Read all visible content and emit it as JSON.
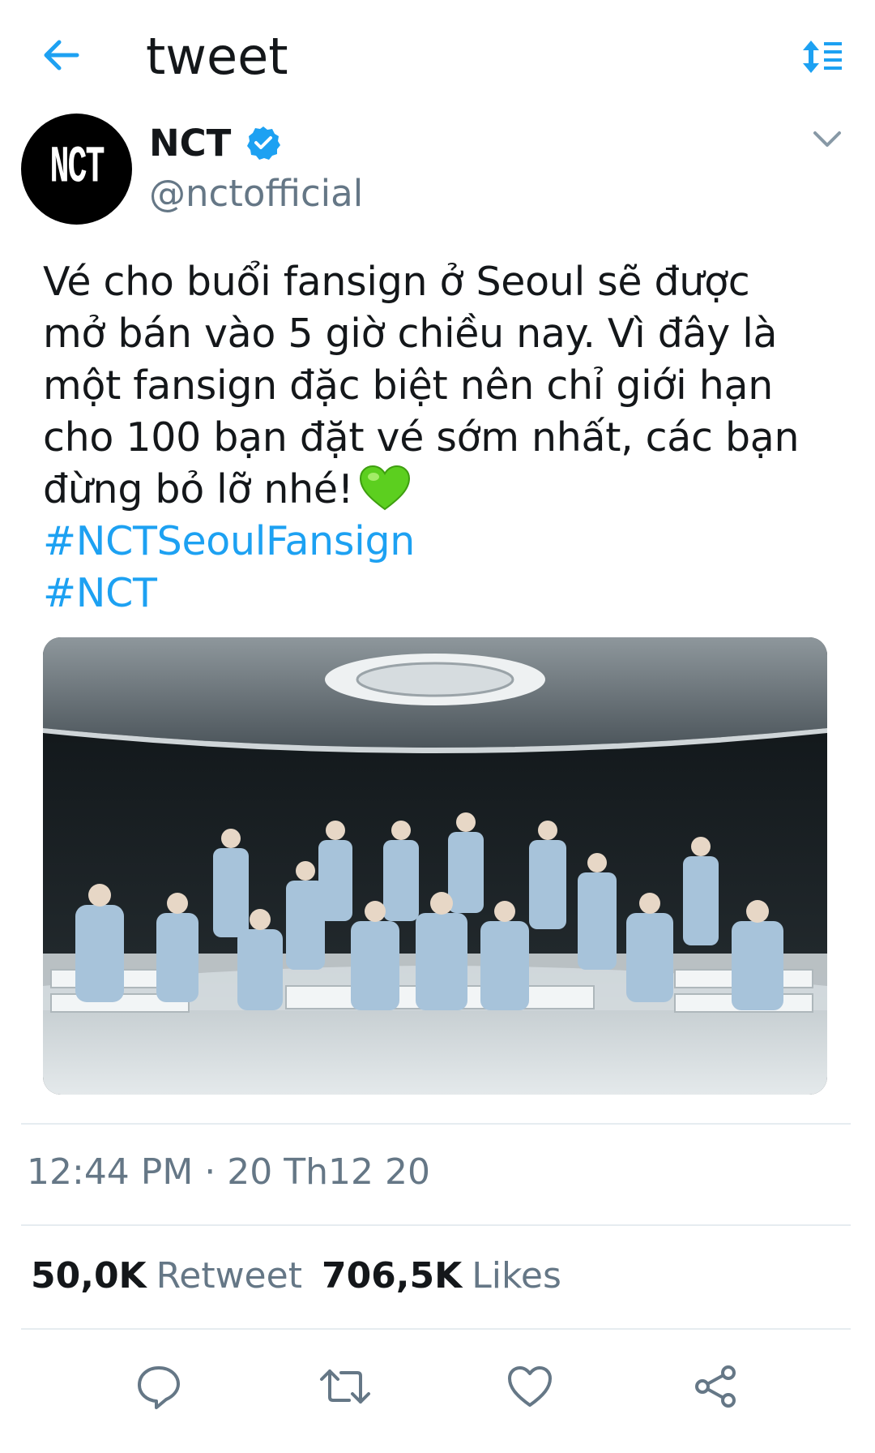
{
  "header": {
    "title": "tweet",
    "back_icon": "back-arrow-icon",
    "sort_icon": "sort-icon",
    "accent_color": "#1da1f2"
  },
  "author": {
    "display_name": "NCT",
    "handle": "@nctofficial",
    "avatar_text": "NCT",
    "verified": true
  },
  "tweet": {
    "lines": [
      "Vé cho buổi fansign ở Seoul sẽ được",
      "mở bán vào 5 giờ chiều nay. Vì đây là",
      "một fansign đặc biệt nên chỉ giới hạn",
      "cho 100 bạn đặt vé sớm nhất, các bạn",
      "đừng bỏ lỡ nhé!"
    ],
    "emoji": "green-heart",
    "hashtags": [
      "#NCTSeoulFansign",
      "#NCT"
    ]
  },
  "meta": {
    "timestamp": "12:44 PM · 20 Th12 20"
  },
  "stats": {
    "retweets_count": "50,0K",
    "retweets_label": "Retweet",
    "likes_count": "706,5K",
    "likes_label": "Likes"
  },
  "actions": [
    "reply-icon",
    "retweet-icon",
    "like-icon",
    "share-icon"
  ]
}
